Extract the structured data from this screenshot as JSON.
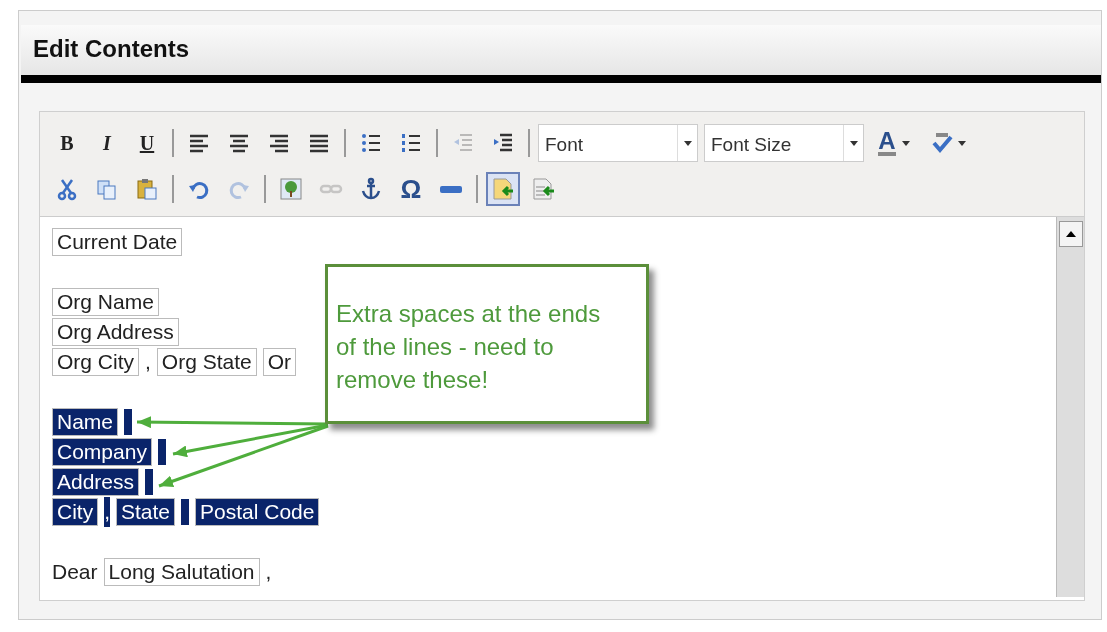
{
  "window": {
    "title": "Edit Contents"
  },
  "toolbar": {
    "rows": [
      [
        {
          "kind": "bold",
          "label": "B"
        },
        {
          "kind": "italic",
          "label": "I"
        },
        {
          "kind": "underline",
          "label": "U"
        },
        {
          "kind": "sep"
        },
        {
          "kind": "align-left"
        },
        {
          "kind": "align-center"
        },
        {
          "kind": "align-right"
        },
        {
          "kind": "justify"
        },
        {
          "kind": "sep"
        },
        {
          "kind": "bullets"
        },
        {
          "kind": "numbers"
        },
        {
          "kind": "sep"
        },
        {
          "kind": "outdent",
          "disabled": true
        },
        {
          "kind": "indent",
          "disabled": false
        },
        {
          "kind": "sep"
        },
        {
          "kind": "select",
          "label": "Font"
        },
        {
          "kind": "select",
          "label": "Font Size"
        },
        {
          "kind": "color",
          "label": "A"
        },
        {
          "kind": "spell"
        }
      ],
      [
        {
          "kind": "cut"
        },
        {
          "kind": "copy"
        },
        {
          "kind": "paste"
        },
        {
          "kind": "sep"
        },
        {
          "kind": "undo",
          "disabled": false
        },
        {
          "kind": "redo",
          "disabled": true
        },
        {
          "kind": "sep"
        },
        {
          "kind": "image"
        },
        {
          "kind": "link",
          "disabled": true
        },
        {
          "kind": "anchor"
        },
        {
          "kind": "symbol",
          "label": "Ω"
        },
        {
          "kind": "rule"
        },
        {
          "kind": "sep"
        },
        {
          "kind": "source",
          "selected": true
        },
        {
          "kind": "template",
          "selected": false
        }
      ]
    ]
  },
  "content": {
    "paragraphs": [
      [
        [
          {
            "kind": "field",
            "text": "Current Date",
            "selected": false
          }
        ]
      ],
      [
        [
          {
            "kind": "field",
            "text": "Org Name",
            "selected": false
          }
        ],
        [
          {
            "kind": "field",
            "text": "Org Address",
            "selected": false
          }
        ],
        [
          {
            "kind": "field",
            "text": "Org City",
            "selected": false
          },
          {
            "kind": "text",
            "text": ",",
            "selected": false
          },
          {
            "kind": "field",
            "text": "Org State",
            "selected": false
          },
          {
            "kind": "field",
            "text": "Or",
            "selected": false
          }
        ]
      ],
      [
        [
          {
            "kind": "field",
            "text": "Name",
            "selected": true
          },
          {
            "kind": "space",
            "selected": true
          }
        ],
        [
          {
            "kind": "field",
            "text": "Company",
            "selected": true
          },
          {
            "kind": "space",
            "selected": true
          }
        ],
        [
          {
            "kind": "field",
            "text": "Address",
            "selected": true
          },
          {
            "kind": "space",
            "selected": true
          }
        ],
        [
          {
            "kind": "field",
            "text": "City",
            "selected": true
          },
          {
            "kind": "text",
            "text": ",",
            "selected": true
          },
          {
            "kind": "field",
            "text": "State",
            "selected": true
          },
          {
            "kind": "space",
            "selected": true
          },
          {
            "kind": "field",
            "text": "Postal Code",
            "selected": true
          }
        ]
      ],
      [
        [
          {
            "kind": "text",
            "text": "Dear",
            "selected": false
          },
          {
            "kind": "field",
            "text": "Long Salutation",
            "selected": false
          },
          {
            "kind": "text",
            "text": ",",
            "selected": false
          }
        ]
      ]
    ]
  },
  "callout": {
    "text": "Extra spaces at the ends of the lines - need to remove these!"
  }
}
